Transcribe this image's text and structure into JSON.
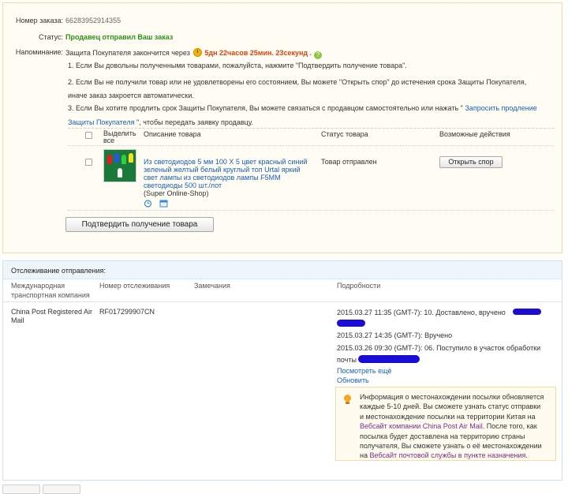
{
  "order": {
    "number_label": "Номер заказа:",
    "number_value": "66283952914355",
    "status_label": "Статус:",
    "status_value": "Продавец отправил Ваш заказ",
    "reminder_label": "Напоминание:",
    "reminder_prefix": "Защита Покупателя закончится через",
    "reminder_timer": "5дн 22часов 25мин. 23секунд .",
    "help_glyph": "?",
    "note1": "1. Если Вы довольны полученными товарами, пожалуйста, нажмите \"Подтвердить получение товара\".",
    "note2_line1": "2. Если Вы не получили товар или не удовлетворены его состоянием, Вы можете \"Открыть спор\" до истечения срока Защиты Покупателя,",
    "note2_line2": "иначе заказ закроется автоматически.",
    "note3_prefix": "3. Если Вы хотите продлить срок Защиты Покупателя, Вы можете связаться с продавцом самостоятельно или нажать \"",
    "note3_link1": "Запросить продление",
    "note3_link2": "Защиты Покупателя",
    "note3_suffix": "\", чтобы передать заявку продавцу."
  },
  "product_table": {
    "col_select_line1": "Выделить",
    "col_select_line2": "все",
    "col_description": "Описание товара",
    "col_status": "Статус товара",
    "col_actions": "Возможные действия",
    "item": {
      "title_line1": "Из светодиодов 5 мм 100 X 5 цвет красный синий",
      "title_line2": "зеленый желтый белый круглый топ Urtal яркий",
      "title_line3": "свет лампы из светодиодов лампы F5MM",
      "title_line4": "светодиоды 500 шт./лот",
      "seller": "(Super Online-Shop)",
      "status": "Товар отправлен",
      "dispute_button": "Открыть спор"
    }
  },
  "confirm_button": "Подтвердить получение товара",
  "tracking": {
    "title": "Отслеживание отправления:",
    "col_company_line1": "Международная",
    "col_company_line2": "транспортная компания",
    "col_number": "Номер отслеживания",
    "col_notes": "Замечания",
    "col_details": "Подробности",
    "company_line1": "China Post Registered Air",
    "company_line2": "Mail",
    "tracking_number": "RF017299907CN",
    "events": [
      "2015.03.27 11:35 (GMT-7): 10. Доставлено, вручено",
      "2015.03.27 14:35 (GMT-7): Вручено",
      "2015.03.26 09:30 (GMT-7): 06. Поступило в участок обработки",
      "почты"
    ],
    "see_more": "Посмотреть ещё",
    "refresh": "Обновить",
    "info": {
      "line1": "Информация о местонахождении посылки обновляется",
      "line2": "каждые 5-10 дней. Вы сможете узнать статус отправки",
      "line3": "и местонахождение посылки на территории Китая на",
      "line4_link": "Вебсайт компании China Post Air Mail",
      "line4_suffix": ". После того, как",
      "line5": "посылка будет доставлена на территорию страны",
      "line6": "получателя, Вы сможете узнать о её местонахождении",
      "line7_prefix": "на ",
      "line7_link": "Вебсайт почтовой службы в пункте назначения",
      "line7_suffix": "."
    }
  },
  "colors": {
    "status_green": "#2c8f1a",
    "timer_orange": "#d9440f",
    "link_blue": "#1a5fb4",
    "panel_bg": "#fffdf3",
    "redaction_blue": "#1a0bd6"
  },
  "icons": [
    "clock-icon",
    "help-icon",
    "alarm-icon",
    "calendar-icon",
    "lightbulb-icon"
  ]
}
